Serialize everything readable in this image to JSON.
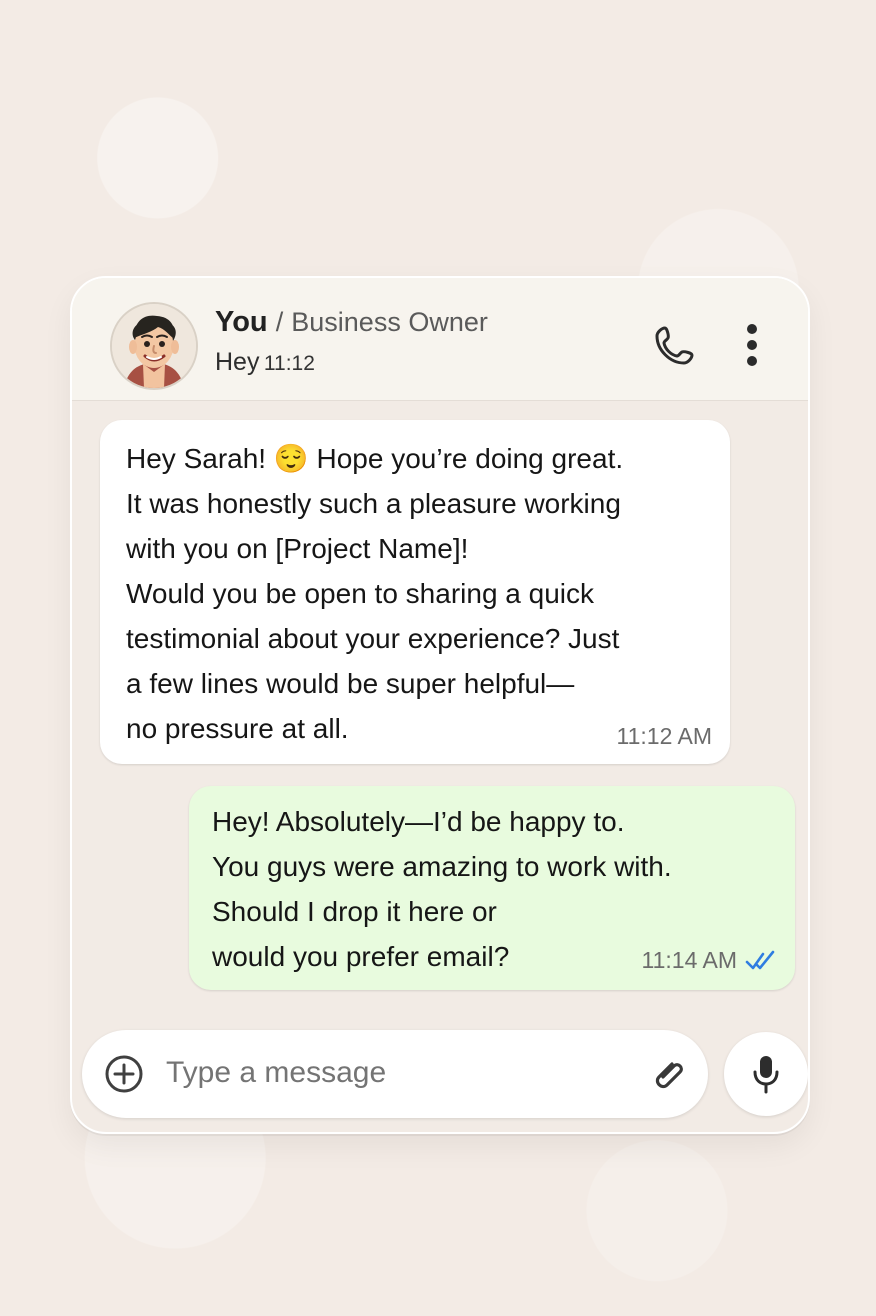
{
  "header": {
    "name": "You",
    "separator": "/",
    "role": "Business Owner",
    "status": "Hey",
    "time": "11:12"
  },
  "messages": [
    {
      "direction": "incoming",
      "text": "Hey Sarah! 😌 Hope you’re doing great.\nIt was honestly such a pleasure working\nwith you on [Project Name]!\nWould you be open to sharing a quick\ntestimonial about your experience? Just\na few lines would be super helpful—\nno pressure at all.",
      "time": "11:12 AM"
    },
    {
      "direction": "outgoing",
      "text": "Hey! Absolutely—I’d be happy to.\nYou guys were amazing to work with.\nShould I drop it here or\nwould you prefer email?",
      "time": "11:14 AM",
      "status": "read"
    }
  ],
  "composer": {
    "placeholder": "Type a message"
  },
  "icons": {
    "call": "phone-icon",
    "menu": "more-vertical-icon",
    "attach": "paperclip-icon",
    "add": "plus-circle-icon",
    "voice": "microphone-icon",
    "read": "double-check-icon"
  },
  "colors": {
    "background": "#f3ebe5",
    "header": "#f7f4ee",
    "incoming_bubble": "#ffffff",
    "outgoing_bubble": "#e8fbde",
    "read_check": "#2f7de1"
  }
}
